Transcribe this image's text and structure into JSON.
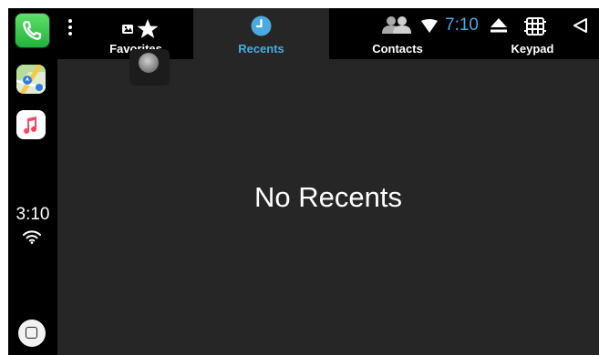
{
  "rail": {
    "apps": [
      {
        "name": "Phone",
        "icon": "phone-app-icon"
      },
      {
        "name": "Maps",
        "icon": "maps-app-icon"
      },
      {
        "name": "Music",
        "icon": "music-app-icon"
      }
    ],
    "time": "3:10",
    "wifi_icon": "wifi-icon",
    "home_icon": "home-button-icon"
  },
  "tabs": [
    {
      "label": "Favorites",
      "icon": "star-icon",
      "active": false
    },
    {
      "label": "Recents",
      "icon": "clock-icon",
      "active": true
    },
    {
      "label": "Contacts",
      "icon": "contacts-icon",
      "active": false
    },
    {
      "label": "Keypad",
      "icon": "keypad-icon",
      "active": false
    }
  ],
  "status": {
    "time": "7:10",
    "icons": [
      "contacts-icon",
      "signal-icon",
      "eject-icon",
      "keypad-icon",
      "back-icon"
    ]
  },
  "main": {
    "empty_message": "No Recents"
  },
  "colors": {
    "accent": "#4aa9e0",
    "background": "#262626",
    "bar": "#000000",
    "text": "#ffffff"
  }
}
